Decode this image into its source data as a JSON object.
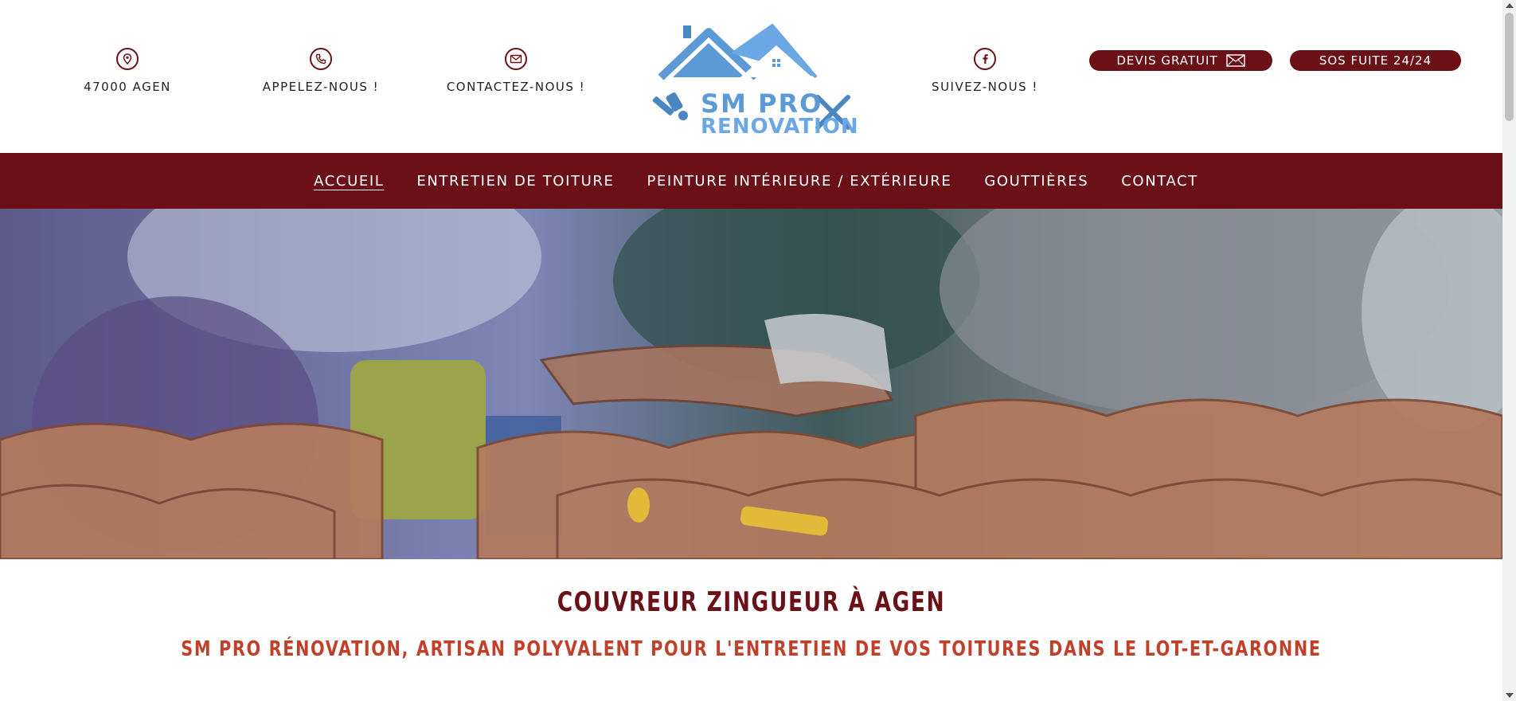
{
  "header": {
    "address": "47000 AGEN",
    "phone_label": "APPELEZ-NOUS !",
    "contact_label": "CONTACTEZ-NOUS !",
    "social_label": "SUIVEZ-NOUS !",
    "logo_line1": "SM PRO",
    "logo_line2": "RENOVATION",
    "devis_label": "DEVIS GRATUIT",
    "sos_label": "SOS FUITE 24/24"
  },
  "nav": {
    "items": [
      {
        "label": "ACCUEIL",
        "active": true
      },
      {
        "label": "ENTRETIEN DE TOITURE"
      },
      {
        "label": "PEINTURE INTÉRIEURE / EXTÉRIEURE"
      },
      {
        "label": "GOUTTIÈRES"
      },
      {
        "label": "CONTACT"
      }
    ]
  },
  "content": {
    "title": "COUVREUR ZINGUEUR À AGEN",
    "subtitle": "SM PRO RÉNOVATION, ARTISAN POLYVALENT POUR L'ENTRETIEN DE VOS TOITURES DANS LE LOT-ET-GARONNE"
  },
  "colors": {
    "brand": "#6b1016",
    "accent": "#c0402a",
    "logo_blue": "#5b9ad6"
  },
  "icons": {
    "address": "map-pin-icon",
    "phone": "phone-icon",
    "mail": "mail-icon",
    "social": "facebook-icon",
    "devis": "envelope-icon"
  }
}
